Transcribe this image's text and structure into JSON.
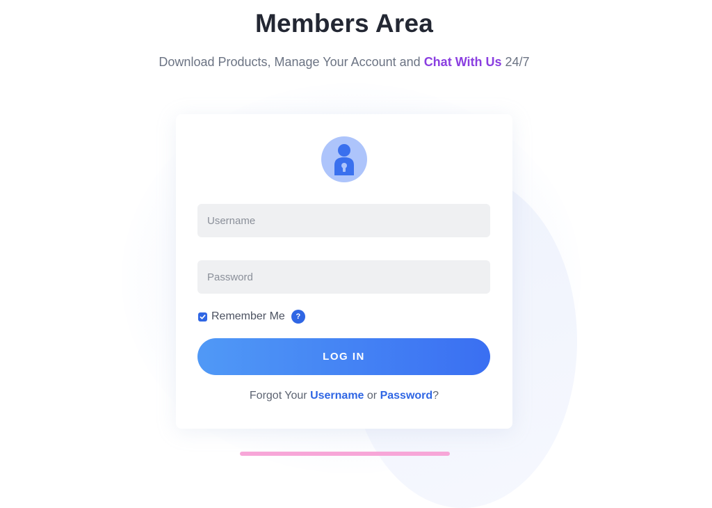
{
  "header": {
    "title": "Members Area",
    "subtitle_prefix": "Download Products, Manage Your Account and ",
    "chat_link": "Chat With Us",
    "subtitle_suffix": " 24/7"
  },
  "login_form": {
    "avatar_icon": "user-lock-icon",
    "username_placeholder": "Username",
    "username_value": "",
    "password_placeholder": "Password",
    "password_value": "",
    "remember_label": "Remember Me",
    "remember_checked": true,
    "help_icon_glyph": "?",
    "login_button": "LOG IN",
    "forgot_prefix": "Forgot Your ",
    "forgot_username_link": "Username",
    "forgot_or": " or ",
    "forgot_password_link": "Password",
    "forgot_suffix": "?"
  },
  "colors": {
    "accent_blue": "#2f66e4",
    "chat_purple": "#8a3ee0",
    "button_gradient_start": "#5099f6",
    "button_gradient_end": "#3a6ff2",
    "avatar_bg": "#adc4fb",
    "input_bg": "#eff0f2"
  }
}
